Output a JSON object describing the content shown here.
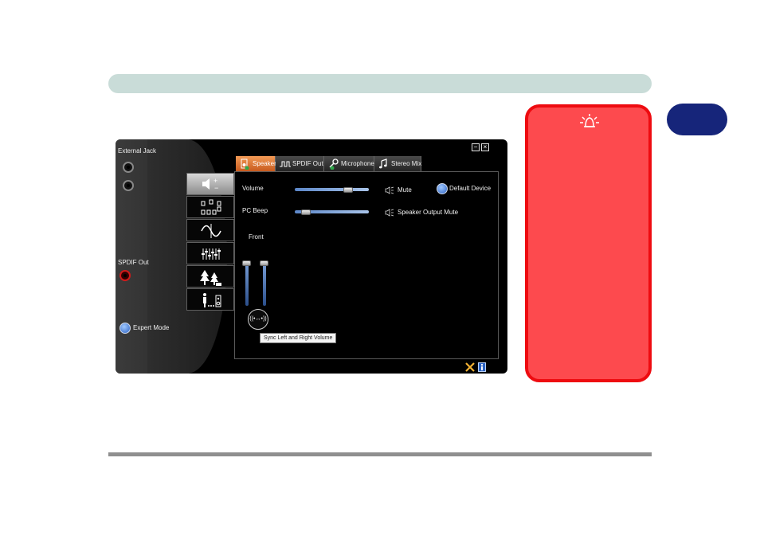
{
  "app": {
    "external_jack_label": "External Jack",
    "spdif_out_label": "SPDIF Out",
    "expert_mode_label": "Expert Mode",
    "minimize_symbol": "−",
    "close_symbol": "×",
    "tabs": [
      {
        "label": "Speaker",
        "icon": "speaker-icon"
      },
      {
        "label": "SPDIF Out",
        "icon": "spdif-waveform-icon"
      },
      {
        "label": "Microphone",
        "icon": "microphone-icon"
      },
      {
        "label": "Stereo Mix",
        "icon": "music-note-icon"
      }
    ],
    "volume_label": "Volume",
    "volume_level": 0.75,
    "mute_label": "Mute",
    "default_device_label": "Default Device",
    "pc_beep_label": "PC Beep",
    "pc_beep_level": 0.1,
    "speaker_output_mute_label": "Speaker Output Mute",
    "front_label": "Front",
    "left_channel_level": 0.9,
    "right_channel_level": 0.9,
    "sync_button_symbol": "((•↔•))",
    "sync_tooltip": "Sync Left and Right Volume"
  },
  "colors": {
    "note_fill": "#fd4a4e",
    "note_border": "#ee0b10",
    "chapter_tab": "#16257a",
    "top_bar": "#c9dcd8",
    "active_tab": "#e07a3a"
  }
}
